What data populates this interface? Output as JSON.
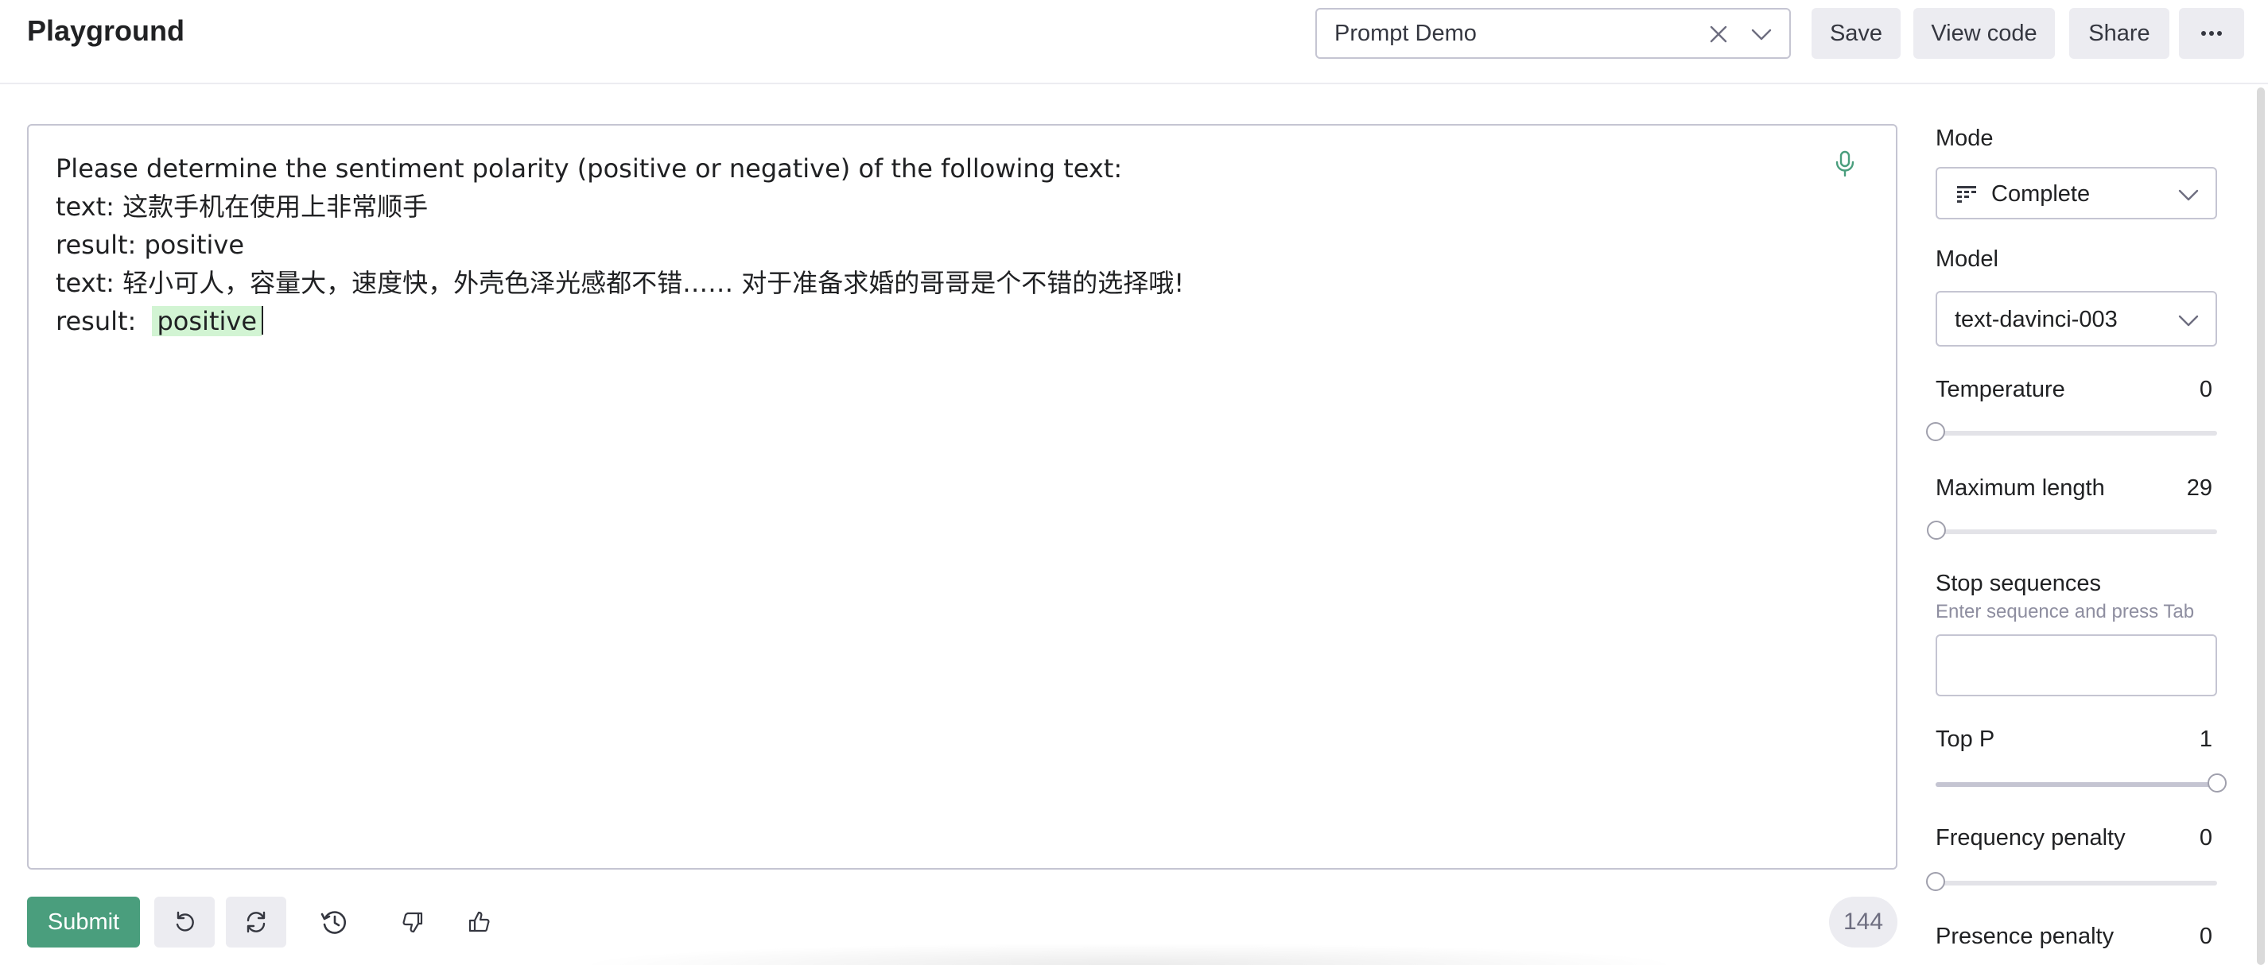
{
  "header": {
    "title": "Playground",
    "preset": {
      "selected": "Prompt Demo",
      "clear_icon": "close-icon",
      "dropdown_icon": "chevron-down-icon"
    },
    "buttons": {
      "save": "Save",
      "view_code": "View code",
      "share": "Share",
      "more_icon": "ellipsis-icon"
    }
  },
  "editor": {
    "lines": [
      "Please determine the sentiment polarity (positive or negative) of the following text:",
      "text: 这款手机在使用上非常顺手",
      "result: positive",
      "text: 轻小可人，容量大，速度快，外壳色泽光感都不错…… 对于准备求婚的哥哥是个不错的选择哦!",
      "result: "
    ],
    "completion": "positive",
    "mic_icon": "microphone-icon",
    "completion_color": "#d2f4d3"
  },
  "toolbar": {
    "submit": "Submit",
    "submit_color": "#4a9e7d",
    "icons": [
      "undo-icon",
      "regenerate-icon",
      "history-icon",
      "thumbs-down-icon",
      "thumbs-up-icon"
    ],
    "token_count": "144"
  },
  "settings": {
    "mode": {
      "label": "Mode",
      "value": "Complete",
      "icon": "complete-mode-icon"
    },
    "model": {
      "label": "Model",
      "value": "text-davinci-003"
    },
    "temperature": {
      "label": "Temperature",
      "value": "0",
      "fraction": 0
    },
    "max_length": {
      "label": "Maximum length",
      "value": "29",
      "fraction": 0.002
    },
    "stop_sequences": {
      "label": "Stop sequences",
      "hint": "Enter sequence and press Tab",
      "value": ""
    },
    "top_p": {
      "label": "Top P",
      "value": "1",
      "fraction": 1
    },
    "frequency_penalty": {
      "label": "Frequency penalty",
      "value": "0",
      "fraction": 0
    },
    "presence_penalty": {
      "label": "Presence penalty",
      "value": "0"
    }
  }
}
